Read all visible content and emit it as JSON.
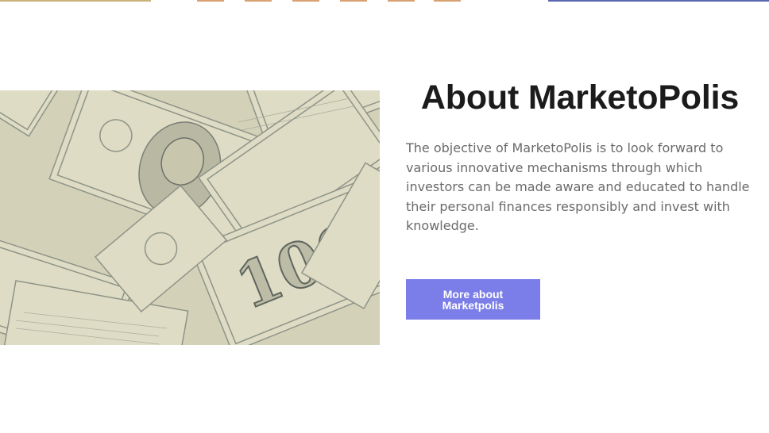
{
  "about": {
    "title": "About MarketoPolis",
    "description": "The objective of MarketoPolis is to look forward to various innovative mechanisms through which investors can be made aware and educated to handle their personal finances responsibly and invest with knowledge.",
    "button_label": "More about Marketpolis"
  },
  "image": {
    "subject": "Scattered 100 dollar bills",
    "banknote_text": "100",
    "colors": {
      "paper": "#dedcc4",
      "ink": "#8f9488",
      "dark_ink": "#5f665f"
    }
  },
  "colors": {
    "title": "#1b1b1b",
    "body_text": "#6a6a6a",
    "button_bg": "#7b7ee8",
    "button_text": "#ffffff"
  }
}
